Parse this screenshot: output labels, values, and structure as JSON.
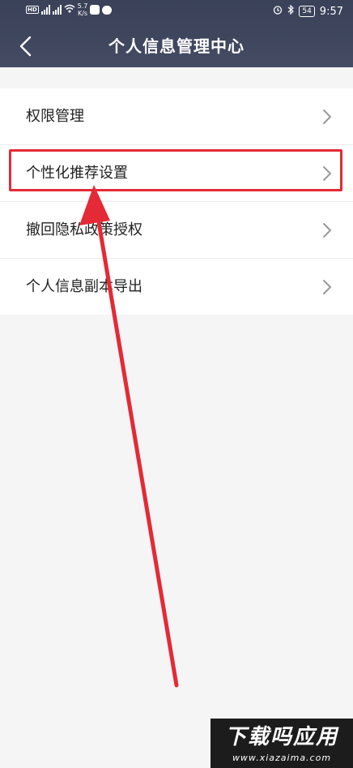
{
  "status_bar": {
    "network_speed_value": "5.7",
    "network_speed_unit": "K/s",
    "battery": "54",
    "time": "9:57"
  },
  "header": {
    "title": "个人信息管理中心",
    "back_icon": "chevron-left-icon"
  },
  "menu": {
    "items": [
      {
        "label": "权限管理"
      },
      {
        "label": "个性化推荐设置",
        "highlighted": true
      },
      {
        "label": "撤回隐私政策授权"
      },
      {
        "label": "个人信息副本导出"
      }
    ],
    "item_icon": "chevron-right-icon"
  },
  "annotation": {
    "highlight_color": "#e42a36",
    "arrow_color": "#e42a36"
  },
  "watermark": {
    "title": "下载吗应用",
    "url": "www.xiazaima.com"
  },
  "colors": {
    "header_bg": "#3f465e",
    "page_bg": "#f5f5f6"
  }
}
